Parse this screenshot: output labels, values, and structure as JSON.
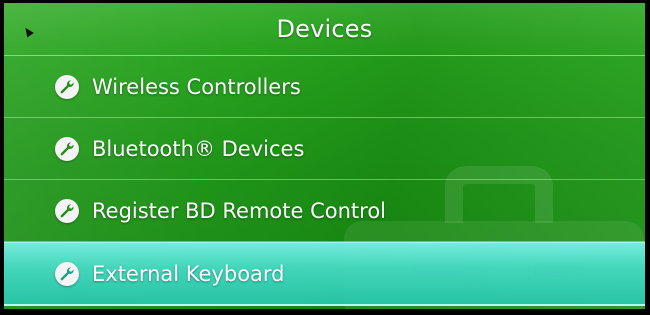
{
  "header": {
    "title": "Devices"
  },
  "menu": {
    "items": [
      {
        "label": "Wireless Controllers",
        "icon": "wrench-icon"
      },
      {
        "label": "Bluetooth® Devices",
        "icon": "wrench-icon"
      },
      {
        "label": "Register BD Remote Control",
        "icon": "wrench-icon"
      },
      {
        "label": "External Keyboard",
        "icon": "wrench-icon",
        "selected": true
      }
    ]
  },
  "colors": {
    "background": "#1f9917",
    "selected_row": "#46dcc8",
    "text": "#ffffff"
  }
}
